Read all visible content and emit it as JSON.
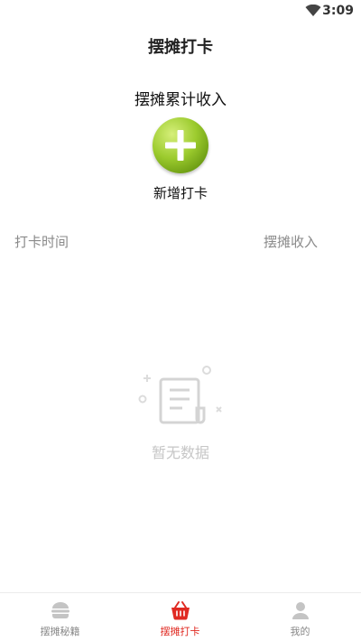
{
  "status_bar": {
    "time": "3:09",
    "wifi_icon": "wifi-icon"
  },
  "header": {
    "title": "摆摊打卡"
  },
  "summary": {
    "total_income_label": "摆摊累计收入"
  },
  "add_checkin": {
    "label": "新增打卡",
    "icon": "plus-icon",
    "color": "#8dbf24"
  },
  "table": {
    "columns": [
      "打卡时间",
      "摆摊收入"
    ]
  },
  "empty_state": {
    "text": "暂无数据",
    "icon": "document-icon"
  },
  "bottom_nav": {
    "items": [
      {
        "label": "摆摊秘籍",
        "icon": "burger-icon",
        "active": false
      },
      {
        "label": "摆摊打卡",
        "icon": "basket-icon",
        "active": true
      },
      {
        "label": "我的",
        "icon": "user-icon",
        "active": false
      }
    ],
    "active_color": "#e02a22",
    "inactive_color": "#888888"
  }
}
